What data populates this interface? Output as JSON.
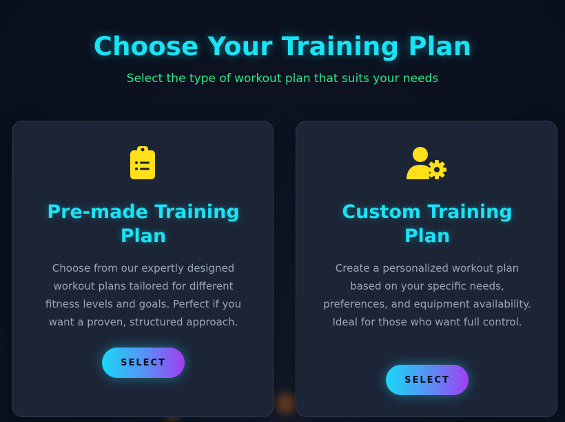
{
  "header": {
    "title": "Choose Your Training Plan",
    "subtitle": "Select the type of workout plan that suits your needs"
  },
  "plans": [
    {
      "icon": "clipboard-list-icon",
      "title_line1": "Pre-made Training",
      "title_line2": "Plan",
      "description": "Choose from our expertly designed workout plans tailored for different fitness levels and goals. Perfect if you want a proven, structured approach.",
      "button_label": "SELECT"
    },
    {
      "icon": "user-gear-icon",
      "title_line1": "Custom Training",
      "title_line2": "Plan",
      "description": "Create a personalized workout plan based on your specific needs, preferences, and equipment availability. Ideal for those who want full control.",
      "button_label": "SELECT"
    }
  ],
  "colors": {
    "accent_cyan": "#19e3f5",
    "accent_green": "#2ee88a",
    "icon_yellow": "#ffe01a",
    "card_bg": "#1c2536",
    "page_bg": "#0b1120"
  }
}
